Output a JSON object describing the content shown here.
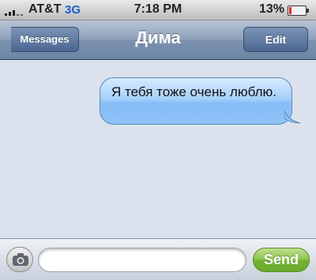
{
  "status_bar": {
    "carrier": "AT&T",
    "network": "3G",
    "time": "7:18 PM",
    "battery_percent_label": "13%",
    "battery_level": 0.13,
    "signal_bars": 5
  },
  "nav": {
    "back_label": "Messages",
    "title": "Дима",
    "edit_label": "Edit"
  },
  "messages": [
    {
      "text": "Я тебя тоже очень люблю.",
      "direction": "outgoing"
    }
  ],
  "composer": {
    "camera_icon": "camera-icon",
    "input_value": "",
    "send_label": "Send"
  },
  "colors": {
    "nav_bar": "#7b91ae",
    "outgoing_bubble": "#a8d0fb",
    "send_button": "#72b431",
    "battery_low": "#d82a2a",
    "network": "#1b5fc9"
  }
}
